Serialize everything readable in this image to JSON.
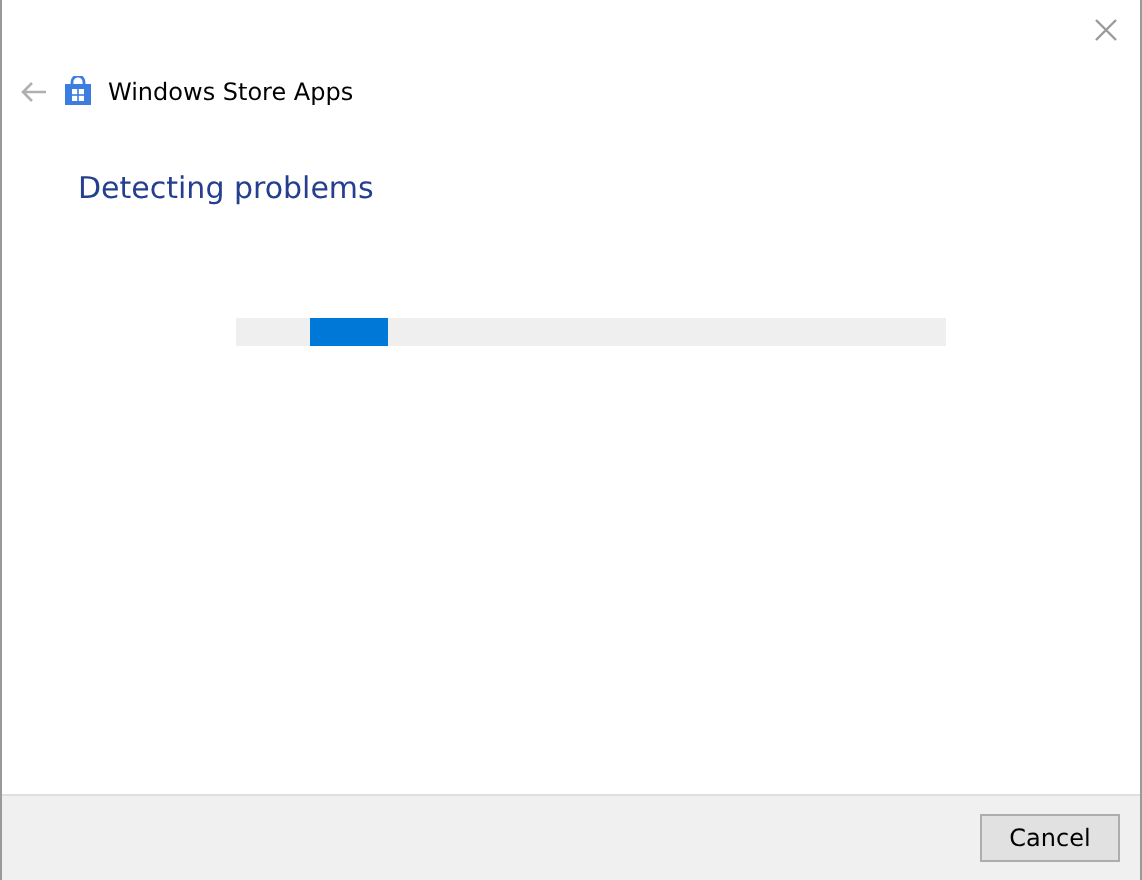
{
  "window": {
    "app_title": "Windows Store Apps"
  },
  "heading": "Detecting problems",
  "progress": {
    "indeterminate": true
  },
  "buttons": [
    "Cancel"
  ]
}
